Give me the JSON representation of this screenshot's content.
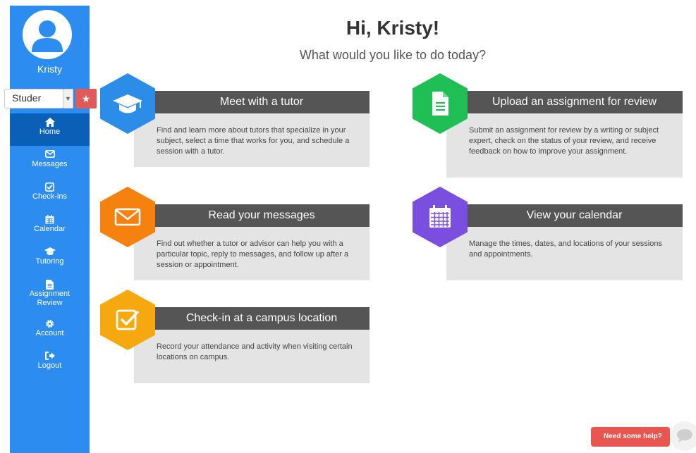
{
  "user": {
    "name": "Kristy"
  },
  "role_select": {
    "value": "Studer"
  },
  "nav": {
    "home": "Home",
    "messages": "Messages",
    "checkins": "Check-ins",
    "calendar": "Calendar",
    "tutoring": "Tutoring",
    "assignment_review_line1": "Assignment",
    "assignment_review_line2": "Review",
    "account": "Account",
    "logout": "Logout"
  },
  "main": {
    "greeting": "Hi, Kristy!",
    "subtitle": "What would you like to do today?"
  },
  "cards": [
    {
      "title": "Meet with a tutor",
      "body": "Find and learn more about tutors that specialize in your subject, select a time that works for you, and schedule a session with a tutor.",
      "icon": "graduation-cap-icon",
      "color": "#2c8de8"
    },
    {
      "title": "Upload an assignment for review",
      "body": "Submit an assignment for review by a writing or subject expert, check on the status of your review, and receive feedback on how to improve your assignment.",
      "icon": "document-icon",
      "color": "#1fbf56"
    },
    {
      "title": "Read your messages",
      "body": "Find out whether a tutor or advisor can help you with a particular topic, reply to messages, and follow up after a session or appointment.",
      "icon": "envelope-icon",
      "color": "#f5820f"
    },
    {
      "title": "View your calendar",
      "body": "Manage the times, dates, and locations of your sessions and appointments.",
      "icon": "calendar-icon",
      "color": "#7a4fe0"
    },
    {
      "title": "Check-in at a campus location",
      "body": "Record your attendance and activity when visiting certain locations on campus.",
      "icon": "checkbox-icon",
      "color": "#f5a90f"
    }
  ],
  "help": {
    "label": "Need some help?"
  },
  "colors": {
    "sidebar": "#2d8cf0",
    "sidebar_active": "#0b5fb6",
    "card_header": "#555555",
    "card_body": "#e4e4e4",
    "help_button": "#e9554f"
  }
}
